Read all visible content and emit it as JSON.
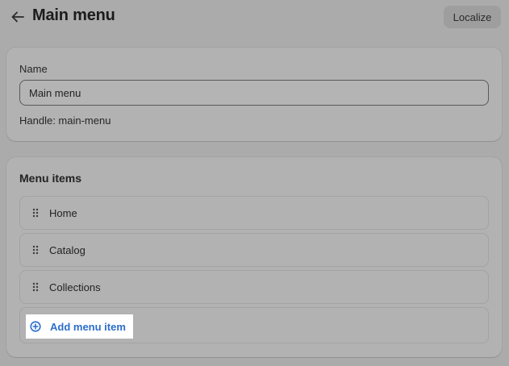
{
  "header": {
    "back_icon": "arrow-left-icon",
    "title": "Main menu",
    "localize_label": "Localize"
  },
  "name_card": {
    "label": "Name",
    "value": "Main menu",
    "handle": "Handle: main-menu"
  },
  "menu_card": {
    "title": "Menu items",
    "items": [
      {
        "label": "Home",
        "icon": "drag-handle-icon"
      },
      {
        "label": "Catalog",
        "icon": "drag-handle-icon"
      },
      {
        "label": "Collections",
        "icon": "drag-handle-icon"
      }
    ],
    "add_label": "Add menu item",
    "add_icon": "circle-plus-icon"
  },
  "colors": {
    "background": "#ababab",
    "card": "#b2b2b2",
    "link": "#2c6ecb",
    "highlight": "#ffffff"
  }
}
